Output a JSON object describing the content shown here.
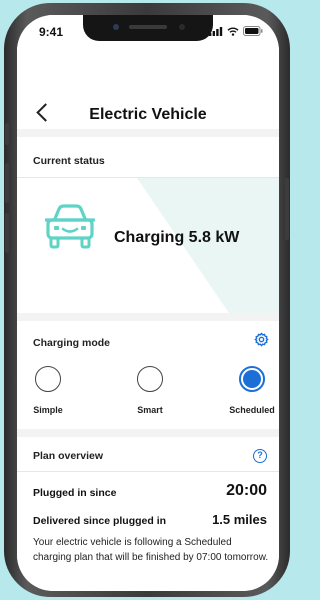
{
  "status_bar": {
    "time": "9:41"
  },
  "header": {
    "title": "Electric Vehicle"
  },
  "current_status": {
    "title": "Current status",
    "charging_text": "Charging 5.8 kW",
    "colors": {
      "accent": "#5fd3c6",
      "band": "#e9f6f4"
    }
  },
  "charging_mode": {
    "title": "Charging mode",
    "options": [
      {
        "label": "Simple",
        "selected": false
      },
      {
        "label": "Smart",
        "selected": false
      },
      {
        "label": "Scheduled",
        "selected": true
      }
    ],
    "accent": "#1b6fd6"
  },
  "plan_overview": {
    "title": "Plan overview",
    "help_icon_text": "?",
    "plugged_in_label": "Plugged in since",
    "plugged_in_value": "20:00",
    "delivered_label": "Delivered since plugged in",
    "delivered_value": "1.5 miles",
    "description": "Your electric vehicle is following a Scheduled charging plan that will be finished by 07:00 tomorrow."
  },
  "icons": [
    "back-chevron-icon",
    "settings-gear-icon",
    "help-icon",
    "car-icon",
    "signal-icon",
    "wifi-icon",
    "battery-icon"
  ]
}
